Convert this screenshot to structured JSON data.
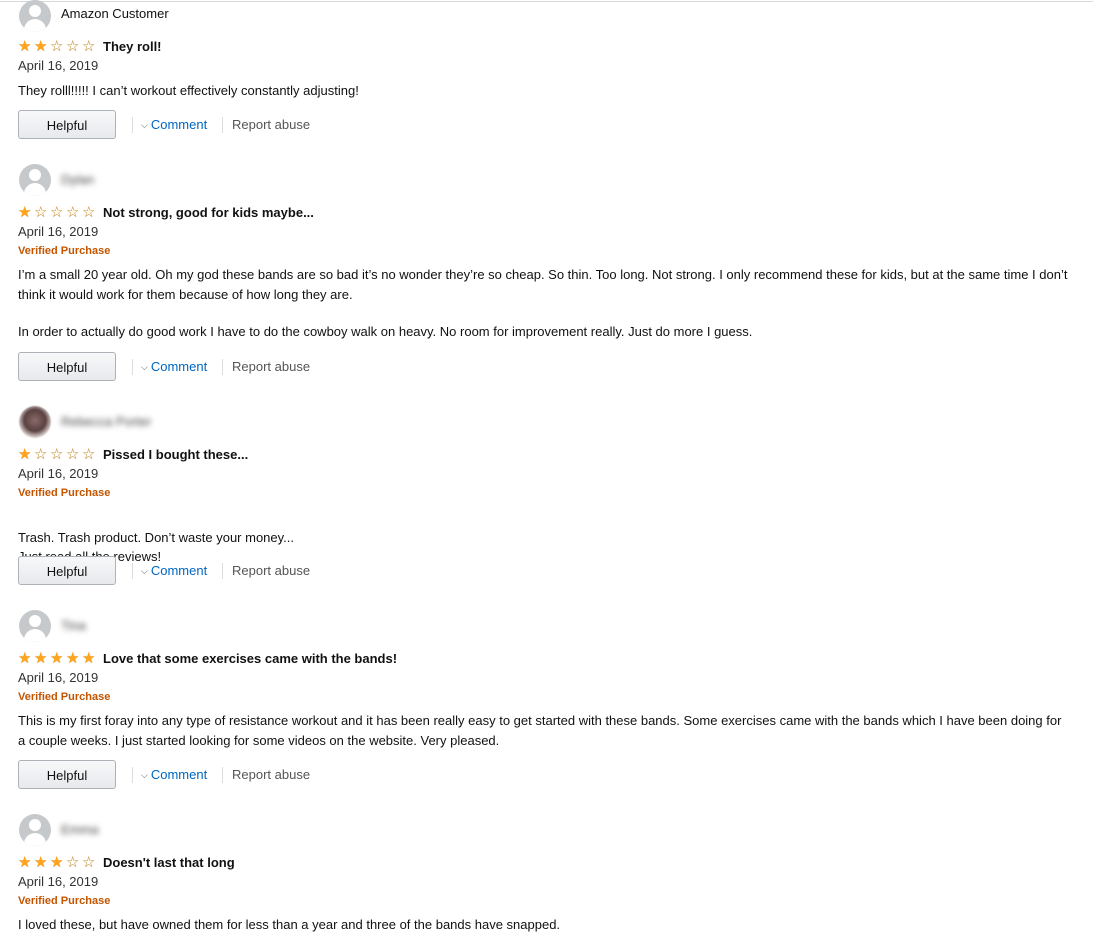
{
  "reviews": [
    {
      "author": "Amazon Customer",
      "author_blurred": false,
      "avatar": "default-avatar",
      "rating": 2,
      "title": "They roll!",
      "date": "April 16, 2019",
      "verified": "",
      "body": [
        "They rolll!!!!! I can’t workout effectively constantly adjusting!"
      ],
      "helpful_label": "Helpful",
      "comment_label": "Comment",
      "report_label": "Report abuse"
    },
    {
      "author": "Dylan",
      "author_blurred": true,
      "avatar": "default-avatar",
      "rating": 1,
      "title": "Not strong, good for kids maybe...",
      "date": "April 16, 2019",
      "verified": "Verified Purchase",
      "body": [
        "I’m a small 20 year old. Oh my god these bands are so bad it’s no wonder they’re so cheap. So thin. Too long. Not strong. I only recommend these for kids, but at the same time I don’t think it would work for them because of how long they are.",
        "In order to actually do good work I have to do the cowboy walk on heavy. No room for improvement really. Just do more I guess."
      ],
      "helpful_label": "Helpful",
      "comment_label": "Comment",
      "report_label": "Report abuse"
    },
    {
      "author": "Rebecca Porter",
      "author_blurred": true,
      "avatar": "photo-avatar",
      "rating": 1,
      "title": "Pissed I bought these...",
      "date": "April 16, 2019",
      "verified": "Verified Purchase",
      "body": [
        "Trash. Trash product. Don’t waste your money...\nJust read all the reviews!"
      ],
      "helpful_label": "Helpful",
      "comment_label": "Comment",
      "report_label": "Report abuse"
    },
    {
      "author": "Tina",
      "author_blurred": true,
      "avatar": "default-avatar",
      "rating": 5,
      "title": "Love that some exercises came with the bands!",
      "date": "April 16, 2019",
      "verified": "Verified Purchase",
      "body": [
        "This is my first foray into any type of resistance workout and it has been really easy to get started with these bands. Some exercises came with the bands which I have been doing for a couple weeks. I just started looking for some videos on the website. Very pleased."
      ],
      "helpful_label": "Helpful",
      "comment_label": "Comment",
      "report_label": "Report abuse"
    },
    {
      "author": "Emma",
      "author_blurred": true,
      "avatar": "default-avatar",
      "rating": 3,
      "title": "Doesn't last that long",
      "date": "April 16, 2019",
      "verified": "Verified Purchase",
      "body": [
        "I loved these, but have owned them for less than a year and three of the bands have snapped."
      ],
      "helpful_label": "",
      "comment_label": "",
      "report_label": ""
    }
  ],
  "star_colors": {
    "filled": "#ffa41c",
    "empty_outline": "#c07c00"
  },
  "link_color": "#0066c0",
  "verified_color": "#c45500"
}
